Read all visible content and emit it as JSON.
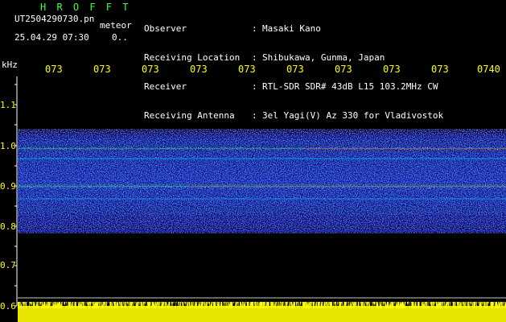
{
  "header": {
    "title": "H R O F F T",
    "filename": "UT2504290730.pn",
    "meteor_label": "meteor",
    "datetime": "25.04.29 07:30",
    "count": "0..",
    "info_labels": [
      "Observer",
      "Receiving Location",
      "Receiver",
      "Receiving Antenna"
    ],
    "info_colons": [
      ":",
      ":",
      ":",
      ":"
    ],
    "info_values": [
      "Masaki Kano",
      "Shibukawa, Gunma, Japan",
      "RTL-SDR SDR# 43dB L15 103.2MHz CW",
      "3el Yagi(V) Az 330 for Vladivostok"
    ]
  },
  "axis": {
    "y_unit": "kHz",
    "y_ticks": [
      "1.1",
      "1.0",
      "0.9",
      "0.8",
      "0.7",
      "0.6"
    ],
    "x_ticks": [
      "073",
      "073",
      "073",
      "073",
      "073",
      "073",
      "073",
      "073",
      "073",
      "0740"
    ]
  },
  "colors": {
    "background": "#000000",
    "label_white": "#ffffff",
    "title_green": "#3cff3c",
    "axis_yellow": "#ffff00",
    "noise_blue": "#1e28ff",
    "echo_green": "#28ff50",
    "echo_red": "#ff2828"
  }
}
